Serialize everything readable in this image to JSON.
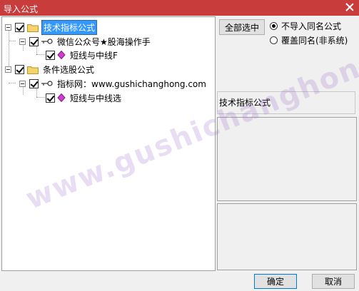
{
  "window": {
    "title": "导入公式"
  },
  "tree": {
    "nodes": [
      {
        "label": "技术指标公式"
      },
      {
        "label": "微信公众号★股海操作手"
      },
      {
        "label": "短线与中线F"
      },
      {
        "label": "条件选股公式"
      },
      {
        "label": "指标网：www.gushichanghong.com"
      },
      {
        "label": "短线与中线选"
      }
    ]
  },
  "options": {
    "select_all_label": "全部选中",
    "radio_skip_label": "不导入同名公式",
    "radio_overwrite_label": "覆盖同名(非系统)",
    "selected_radio": "skip"
  },
  "info": {
    "type_label": "技术指标公式"
  },
  "buttons": {
    "confirm": "确定",
    "cancel": "取消"
  },
  "watermark": "www.gushichanghong.com",
  "colors": {
    "titlebar": "#c83c3c",
    "selection": "#3399ff",
    "folder": "#f5d36b",
    "gem": "#d43cd4"
  }
}
